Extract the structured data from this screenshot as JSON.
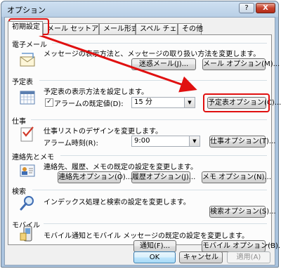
{
  "window": {
    "title": "オプション",
    "help_label": "?",
    "close_label": "X"
  },
  "tabs": [
    {
      "label": "初期設定"
    },
    {
      "label": "メール セットアップ"
    },
    {
      "label": "メール形式"
    },
    {
      "label": "スペル チェック"
    },
    {
      "label": "その他"
    }
  ],
  "sections": {
    "email": {
      "title": "電子メール",
      "description": "メッセージの表示方法と、メッセージの取り扱い方法を変更します。",
      "junk_button": "迷惑メール(J)...",
      "options_button": "メール オプション(M)..."
    },
    "calendar": {
      "title": "予定表",
      "description": "予定表の表示方法を設定します。",
      "reminder_label": "アラームの既定値(D):",
      "reminder_value": "15 分",
      "options_button": "予定表オプション(C)..."
    },
    "tasks": {
      "title": "仕事",
      "description": "仕事リストのデザインを変更します。",
      "alarm_label": "アラーム時刻(R):",
      "alarm_value": "9:00",
      "options_button": "仕事オプション(T)..."
    },
    "contacts": {
      "title": "連絡先とメモ",
      "description": "連絡先、履歴、メモの既定の設定を変更します。",
      "contact_button": "連絡先オプション(O)...",
      "journal_button": "履歴オプション(J)...",
      "notes_button": "メモ オプション(N)..."
    },
    "search": {
      "title": "検索",
      "description": "インデックス処理と検索の設定を変更します。",
      "options_button": "検索オプション(S)..."
    },
    "mobile": {
      "title": "モバイル",
      "description": "モバイル通知とモバイル メッセージの既定の設定を変更します。",
      "notify_button": "通知(F)...",
      "options_button": "モバイル オプション(B)..."
    }
  },
  "footer": {
    "ok": "OK",
    "cancel": "キャンセル",
    "apply": "適用(A)"
  },
  "colors": {
    "highlight": "#e01010",
    "accent": "#3c7fb1"
  }
}
